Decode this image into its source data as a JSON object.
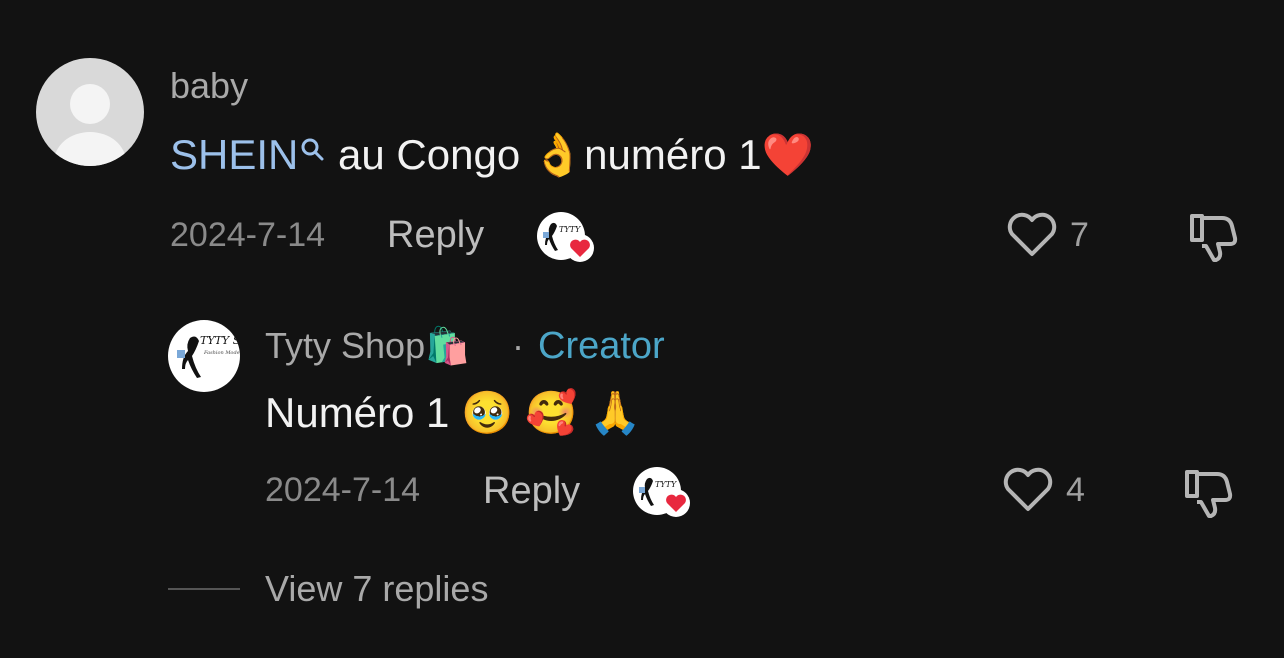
{
  "comment1": {
    "username": "baby",
    "text_link": "SHEIN",
    "text_mid": " au Congo ",
    "emoji_ok": "👌",
    "text_end": "numéro 1",
    "emoji_heart": "❤️",
    "date": "2024-7-14",
    "reply_label": "Reply",
    "likes": "7"
  },
  "reply1": {
    "username": "Tyty Shop",
    "username_emoji": "🛍️",
    "creator_sep": "·",
    "creator_label": "Creator",
    "text": "Numéro 1 ",
    "emojis": "🥹 🥰 🙏",
    "date": "2024-7-14",
    "reply_label": "Reply",
    "likes": "4"
  },
  "view_replies": "View 7 replies",
  "colors": {
    "background": "#121212",
    "link": "#9cc0ea",
    "creator": "#4ca6c8",
    "heart_red": "#e8283f"
  }
}
